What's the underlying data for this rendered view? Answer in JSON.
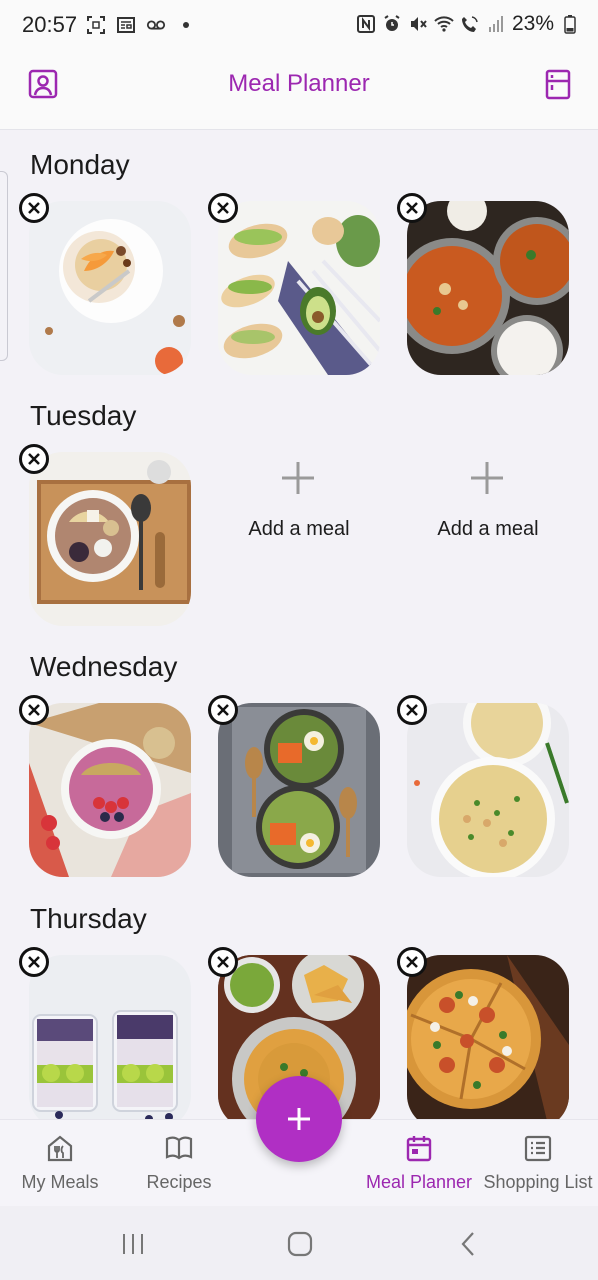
{
  "status_bar": {
    "time": "20:57",
    "battery": "23%",
    "left_icons": [
      "screenshot-icon",
      "news-icon",
      "voicemail-icon",
      "dot-icon"
    ],
    "right_icons": [
      "nfc-icon",
      "alarm-icon",
      "mute-icon",
      "wifi-icon",
      "wifi-call-icon",
      "signal-icon",
      "battery-icon"
    ]
  },
  "app_bar": {
    "title": "Meal Planner",
    "left_icon": "profile-icon",
    "right_icon": "fridge-icon",
    "accent": "#9c27b0"
  },
  "days": [
    {
      "name": "Monday",
      "meals": [
        {
          "type": "meal",
          "image": "yogurt-bowl-photo"
        },
        {
          "type": "meal",
          "image": "tacos-photo"
        },
        {
          "type": "meal",
          "image": "curry-photo"
        }
      ]
    },
    {
      "name": "Tuesday",
      "meals": [
        {
          "type": "meal",
          "image": "smoothie-bowl-photo"
        },
        {
          "type": "add",
          "label": "Add a meal"
        },
        {
          "type": "add",
          "label": "Add a meal"
        }
      ]
    },
    {
      "name": "Wednesday",
      "meals": [
        {
          "type": "meal",
          "image": "berry-bowl-photo"
        },
        {
          "type": "meal",
          "image": "bibimbap-photo"
        },
        {
          "type": "meal",
          "image": "pasta-salad-photo"
        }
      ]
    },
    {
      "name": "Thursday",
      "meals": [
        {
          "type": "meal",
          "image": "chia-parfait-photo"
        },
        {
          "type": "meal",
          "image": "nachos-soup-photo"
        },
        {
          "type": "meal",
          "image": "pizza-photo"
        }
      ]
    }
  ],
  "bottom_nav": {
    "items": [
      {
        "label": "My Meals",
        "icon": "home-cutlery-icon",
        "active": false
      },
      {
        "label": "Recipes",
        "icon": "book-icon",
        "active": false
      },
      {
        "label": "Meal Planner",
        "icon": "calendar-icon",
        "active": true
      },
      {
        "label": "Shopping List",
        "icon": "list-icon",
        "active": false
      }
    ],
    "fab_icon": "plus-icon",
    "fab_color": "#b02fc4"
  },
  "system_nav": [
    "recents-icon",
    "home-icon",
    "back-icon"
  ]
}
